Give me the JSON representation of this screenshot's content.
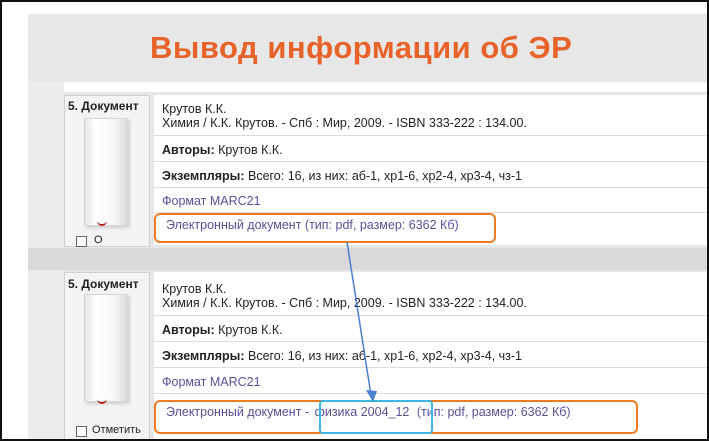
{
  "page": {
    "title": "Вывод информации об ЭР"
  },
  "records": [
    {
      "label": "5. Документ",
      "author": "Крутов К.К.",
      "bib": "Химия / К.К. Крутов. - Спб : Мир, 2009. - ISBN 333-222 : 134.00.",
      "authors_label": "Авторы:",
      "authors_value": "Крутов К.К.",
      "copies_label": "Экземпляры:",
      "copies_value": "Всего: 16, из них: аб-1, хр1-6, хр2-4, хр3-4, чз-1",
      "marc_link": "Формат MARC21",
      "edoc_link": "Электронный документ (тип: pdf, размер: 6362 Кб)",
      "checkbox_label": "О"
    },
    {
      "label": "5. Документ",
      "author": "Крутов К.К.",
      "bib": "Химия / К.К. Крутов. - Спб : Мир, 2009. - ISBN 333-222 : 134.00.",
      "authors_label": "Авторы:",
      "authors_value": "Крутов К.К.",
      "copies_label": "Экземпляры:",
      "copies_value": "Всего: 16, из них: аб-1, хр1-6, хр2-4, хр3-4, чз-1",
      "marc_link": "Формат MARC21",
      "edoc_prefix": "Электронный документ -",
      "edoc_name": "физика 2004_12",
      "edoc_suffix": "(тип: pdf, размер: 6362 Кб)",
      "checkbox_label": "Отметить"
    }
  ],
  "colors": {
    "title": "#e8632a",
    "highlight_orange": "#f07a22",
    "highlight_blue": "#3fb6e8",
    "arrow": "#4a7fd4",
    "link": "#5c4f9a"
  },
  "icons": {
    "document_cover": "book-cover-icon",
    "arrow": "arrow-icon"
  }
}
